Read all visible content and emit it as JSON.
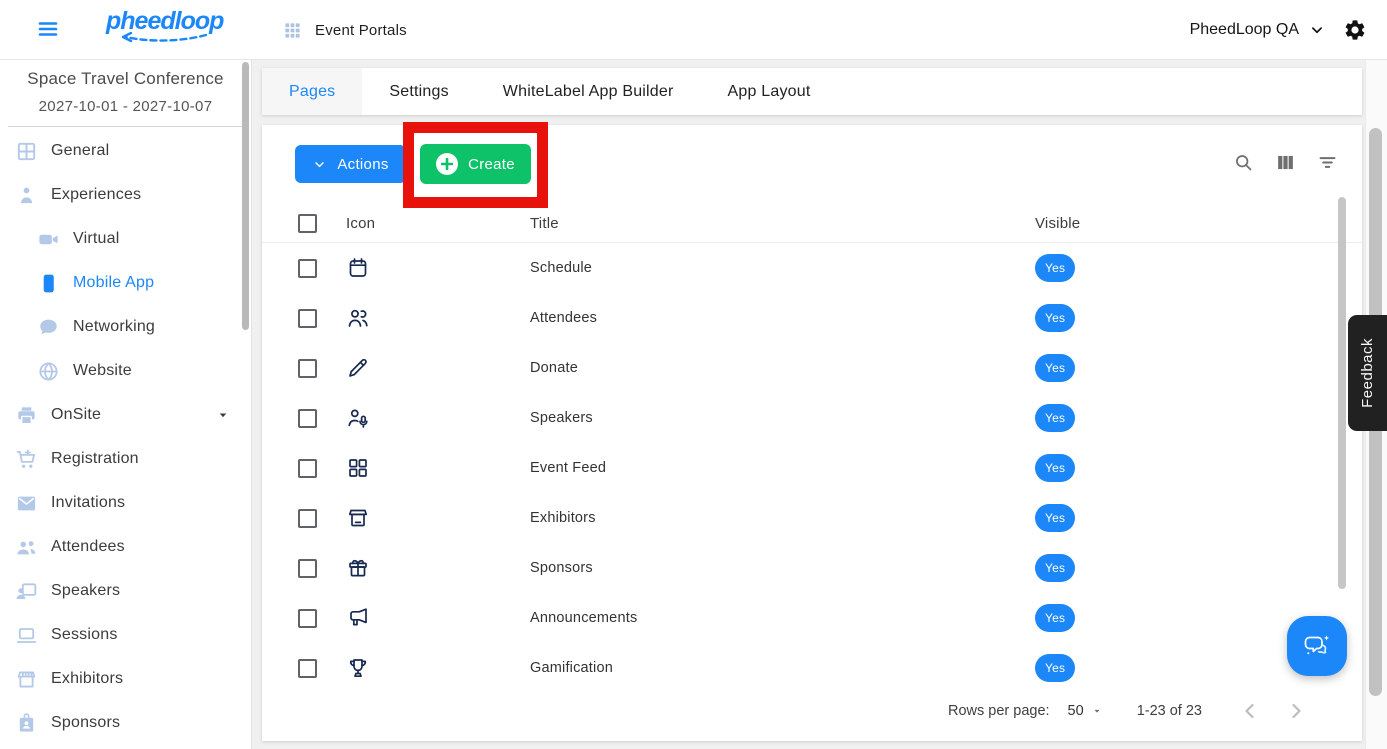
{
  "header": {
    "logo_text": "pheedloop",
    "page_title": "Event Portals",
    "account_label": "PheedLoop QA"
  },
  "sidebar": {
    "event_name": "Space Travel Conference",
    "event_dates": "2027-10-01 - 2027-10-07",
    "items": [
      {
        "label": "General",
        "icon": "window-icon",
        "indent": false,
        "active": false,
        "expandable": false
      },
      {
        "label": "Experiences",
        "icon": "person-icon",
        "indent": false,
        "active": false,
        "expandable": false
      },
      {
        "label": "Virtual",
        "icon": "video-camera-icon",
        "indent": true,
        "active": false,
        "expandable": false
      },
      {
        "label": "Mobile App",
        "icon": "smartphone-icon",
        "indent": true,
        "active": true,
        "expandable": false
      },
      {
        "label": "Networking",
        "icon": "chat-bubble-icon",
        "indent": true,
        "active": false,
        "expandable": false
      },
      {
        "label": "Website",
        "icon": "globe-icon",
        "indent": true,
        "active": false,
        "expandable": false
      },
      {
        "label": "OnSite",
        "icon": "printer-icon",
        "indent": false,
        "active": false,
        "expandable": true
      },
      {
        "label": "Registration",
        "icon": "shopping-cart-icon",
        "indent": false,
        "active": false,
        "expandable": false
      },
      {
        "label": "Invitations",
        "icon": "envelope-icon",
        "indent": false,
        "active": false,
        "expandable": false
      },
      {
        "label": "Attendees",
        "icon": "people-icon",
        "indent": false,
        "active": false,
        "expandable": false
      },
      {
        "label": "Speakers",
        "icon": "presenter-icon",
        "indent": false,
        "active": false,
        "expandable": false
      },
      {
        "label": "Sessions",
        "icon": "laptop-icon",
        "indent": false,
        "active": false,
        "expandable": false
      },
      {
        "label": "Exhibitors",
        "icon": "storefront-icon",
        "indent": false,
        "active": false,
        "expandable": false
      },
      {
        "label": "Sponsors",
        "icon": "id-badge-icon",
        "indent": false,
        "active": false,
        "expandable": false
      }
    ]
  },
  "tabs": [
    {
      "label": "Pages",
      "active": true
    },
    {
      "label": "Settings",
      "active": false
    },
    {
      "label": "WhiteLabel App Builder",
      "active": false
    },
    {
      "label": "App Layout",
      "active": false
    }
  ],
  "toolbar": {
    "actions_label": "Actions",
    "create_label": "Create"
  },
  "table": {
    "columns": [
      "Icon",
      "Title",
      "Visible"
    ],
    "rows": [
      {
        "icon": "calendar-icon",
        "title": "Schedule",
        "visible": "Yes"
      },
      {
        "icon": "two-people-icon",
        "title": "Attendees",
        "visible": "Yes"
      },
      {
        "icon": "pencil-icon",
        "title": "Donate",
        "visible": "Yes"
      },
      {
        "icon": "presenter-mic-icon",
        "title": "Speakers",
        "visible": "Yes"
      },
      {
        "icon": "four-squares-icon",
        "title": "Event Feed",
        "visible": "Yes"
      },
      {
        "icon": "market-stall-icon",
        "title": "Exhibitors",
        "visible": "Yes"
      },
      {
        "icon": "gift-icon",
        "title": "Sponsors",
        "visible": "Yes"
      },
      {
        "icon": "megaphone-icon",
        "title": "Announcements",
        "visible": "Yes"
      },
      {
        "icon": "trophy-icon",
        "title": "Gamification",
        "visible": "Yes"
      }
    ]
  },
  "pagination": {
    "rows_per_page_label": "Rows per page:",
    "rows_per_page_value": "50",
    "range_label": "1-23 of 23"
  },
  "feedback_label": "Feedback",
  "colors": {
    "accent_blue": "#1c87f8",
    "create_green": "#0dc268",
    "annotation_red": "#e8120d",
    "row_icon_navy": "#17294f",
    "sidebar_icon_blue": "#b4c9e8",
    "visible_badge_blue": "#1c87f8",
    "feedback_tab_dark": "#212121"
  }
}
